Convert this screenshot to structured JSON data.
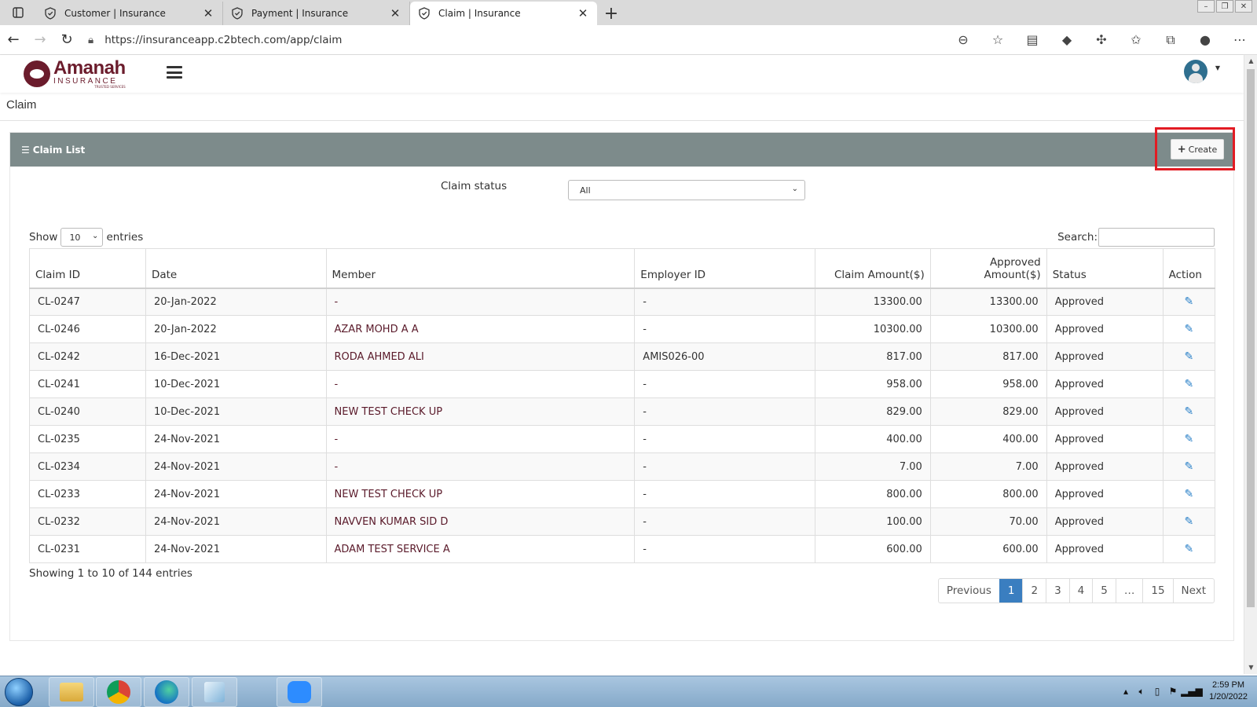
{
  "browser": {
    "tabs": [
      {
        "title": "Customer | Insurance",
        "active": false
      },
      {
        "title": "Payment | Insurance",
        "active": false
      },
      {
        "title": "Claim | Insurance",
        "active": true
      }
    ],
    "url": "https://insuranceapp.c2btech.com/app/claim"
  },
  "app": {
    "logo_name": "Amanah",
    "logo_sub": "INSURANCE",
    "logo_tag": "TRUSTED SERVICES"
  },
  "page": {
    "title": "Claim"
  },
  "card": {
    "header": "Claim List",
    "create_label": "Create",
    "filter_label": "Claim status",
    "filter_value": "All",
    "show_label": "Show",
    "entries_label": "entries",
    "page_length": "10",
    "search_label": "Search:",
    "info": "Showing 1 to 10 of 144 entries"
  },
  "table": {
    "columns": [
      "Claim ID",
      "Date",
      "Member",
      "Employer ID",
      "Claim Amount($)",
      "Approved Amount($)",
      "Status",
      "Action"
    ],
    "approved_line1": "Approved",
    "approved_line2": "Amount($)",
    "rows": [
      {
        "id": "CL-0247",
        "date": "20-Jan-2022",
        "member": "-",
        "employer": "-",
        "claim": "13300.00",
        "approved": "13300.00",
        "status": "Approved"
      },
      {
        "id": "CL-0246",
        "date": "20-Jan-2022",
        "member": "AZAR MOHD A A",
        "employer": "-",
        "claim": "10300.00",
        "approved": "10300.00",
        "status": "Approved"
      },
      {
        "id": "CL-0242",
        "date": "16-Dec-2021",
        "member": "RODA AHMED ALI",
        "employer": "AMIS026-00",
        "claim": "817.00",
        "approved": "817.00",
        "status": "Approved"
      },
      {
        "id": "CL-0241",
        "date": "10-Dec-2021",
        "member": "-",
        "employer": "-",
        "claim": "958.00",
        "approved": "958.00",
        "status": "Approved"
      },
      {
        "id": "CL-0240",
        "date": "10-Dec-2021",
        "member": "NEW TEST CHECK UP",
        "employer": "-",
        "claim": "829.00",
        "approved": "829.00",
        "status": "Approved"
      },
      {
        "id": "CL-0235",
        "date": "24-Nov-2021",
        "member": "-",
        "employer": "-",
        "claim": "400.00",
        "approved": "400.00",
        "status": "Approved"
      },
      {
        "id": "CL-0234",
        "date": "24-Nov-2021",
        "member": "-",
        "employer": "-",
        "claim": "7.00",
        "approved": "7.00",
        "status": "Approved"
      },
      {
        "id": "CL-0233",
        "date": "24-Nov-2021",
        "member": "NEW TEST CHECK UP",
        "employer": "-",
        "claim": "800.00",
        "approved": "800.00",
        "status": "Approved"
      },
      {
        "id": "CL-0232",
        "date": "24-Nov-2021",
        "member": "NAVVEN KUMAR SID D",
        "employer": "-",
        "claim": "100.00",
        "approved": "70.00",
        "status": "Approved"
      },
      {
        "id": "CL-0231",
        "date": "24-Nov-2021",
        "member": "ADAM TEST SERVICE A",
        "employer": "-",
        "claim": "600.00",
        "approved": "600.00",
        "status": "Approved"
      }
    ]
  },
  "pagination": {
    "previous": "Previous",
    "pages": [
      "1",
      "2",
      "3",
      "4",
      "5",
      "…",
      "15"
    ],
    "active": "1",
    "next": "Next"
  },
  "taskbar": {
    "time": "2:59 PM",
    "date": "1/20/2022"
  },
  "colors": {
    "card_header": "#7d8b8b",
    "brand": "#6b1c2c",
    "highlight": "#e21b23",
    "link": "#2a80c8",
    "pager_active": "#3a7ec0"
  }
}
